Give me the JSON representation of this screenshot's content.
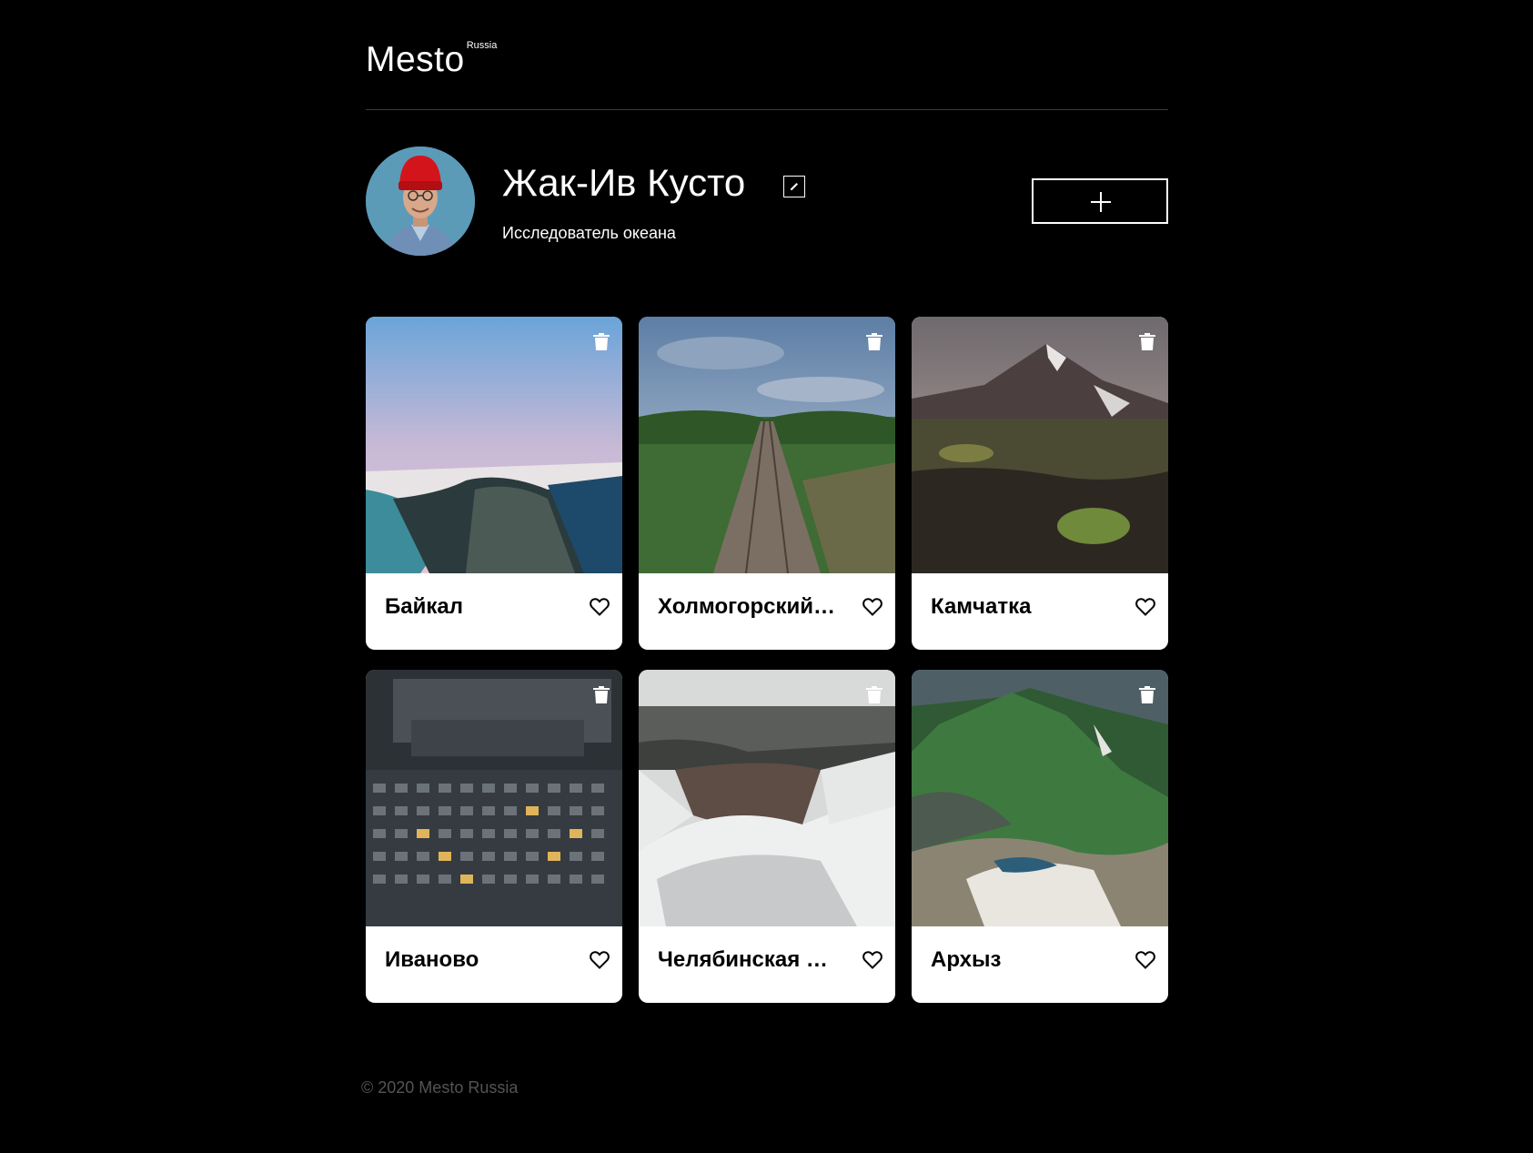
{
  "header": {
    "logo": "Mesto",
    "logo_sub": "Russia"
  },
  "profile": {
    "name": "Жак-Ив Кусто",
    "about": "Исследователь океана",
    "avatar_icon": "avatar-photo",
    "edit_icon": "pencil-icon",
    "add_icon": "plus-icon"
  },
  "cards": [
    {
      "title": "Байкал"
    },
    {
      "title": "Холмогорский район"
    },
    {
      "title": "Камчатка"
    },
    {
      "title": "Иваново"
    },
    {
      "title": "Челябинская область"
    },
    {
      "title": "Архыз"
    }
  ],
  "footer": {
    "text": "© 2020 Mesto Russia"
  }
}
